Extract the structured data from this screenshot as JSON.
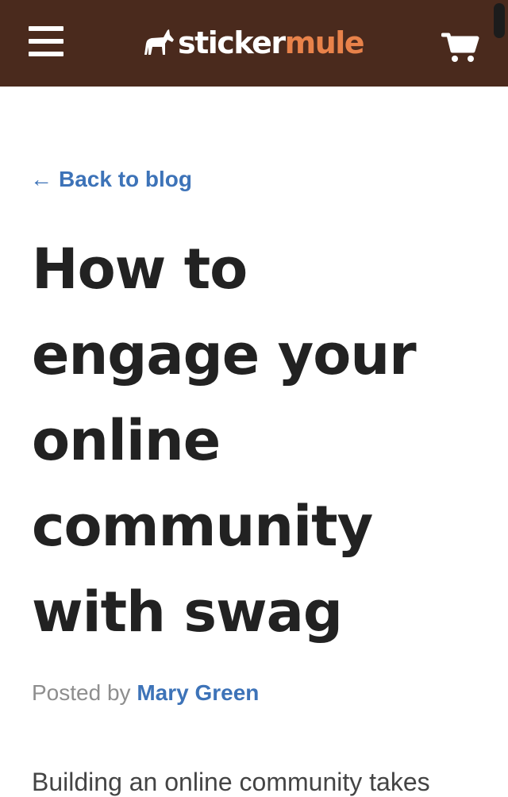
{
  "header": {
    "menu_icon": "hamburger-menu-icon",
    "logo": {
      "icon": "mule-icon",
      "text_part1": "sticker",
      "text_part2": "mule"
    },
    "cart_icon": "shopping-cart-icon"
  },
  "article": {
    "back_arrow": "←",
    "back_label": "Back to blog",
    "title": "How to engage your online community with swag",
    "byline_prefix": "Posted by",
    "author": "Mary Green",
    "body_start": "Building an online community takes"
  },
  "colors": {
    "header_bg": "#4a2a1d",
    "logo_accent": "#e8824a",
    "link": "#3d73b8",
    "title_text": "#222222",
    "muted_text": "#8e8e8e"
  }
}
